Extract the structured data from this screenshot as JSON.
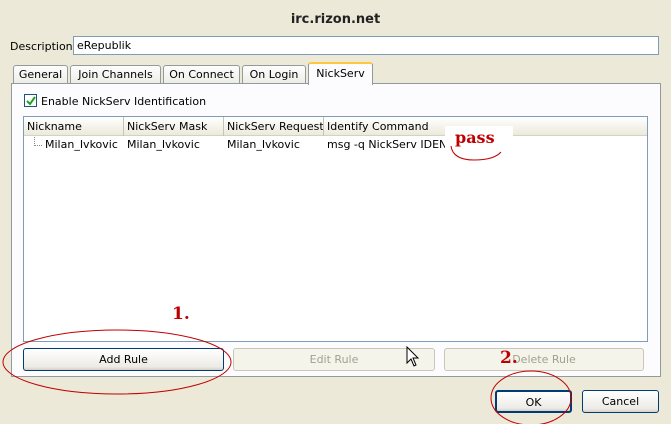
{
  "window": {
    "title": "irc.rizon.net"
  },
  "description": {
    "label": "Description:",
    "value": "eRepublik"
  },
  "tabs": [
    {
      "label": "General"
    },
    {
      "label": "Join Channels"
    },
    {
      "label": "On Connect"
    },
    {
      "label": "On Login"
    },
    {
      "label": "NickServ"
    }
  ],
  "nickserv": {
    "enable_label": "Enable NickServ Identification",
    "enable_checked": true,
    "columns": [
      "Nickname",
      "NickServ Mask",
      "NickServ Request M",
      "Identify Command"
    ],
    "rows": [
      {
        "nickname": "Milan_Ivkovic",
        "mask": "Milan_Ivkovic",
        "request": "Milan_Ivkovic",
        "command": "msg -q NickServ IDENTIFY"
      }
    ],
    "buttons": {
      "add": "Add Rule",
      "edit": "Edit Rule",
      "delete": "Delete Rule"
    }
  },
  "footer": {
    "ok": "OK",
    "cancel": "Cancel"
  },
  "annotations": {
    "pass_note": "pass",
    "step1": "1.",
    "step2": "2.",
    "color": "#c00000"
  }
}
